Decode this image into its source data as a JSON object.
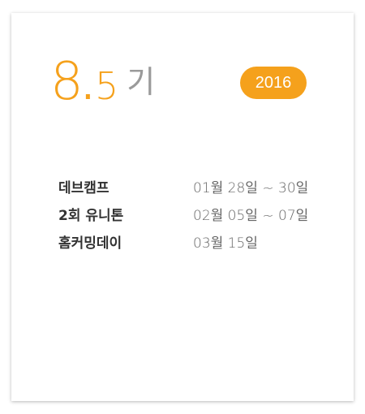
{
  "generation": {
    "major": "8",
    "dot": ".",
    "minor": "5",
    "suffix": "기"
  },
  "year_badge": "2016",
  "schedule": [
    {
      "title": "데브캠프",
      "date": "01월 28일 ~ 30일"
    },
    {
      "title": "2회 유니톤",
      "date": "02월 05일 ~ 07일"
    },
    {
      "title": "홈커밍데이",
      "date": "03월 15일"
    }
  ],
  "colors": {
    "accent": "#f5a11c",
    "title_text": "#333333",
    "date_text": "#666666"
  }
}
